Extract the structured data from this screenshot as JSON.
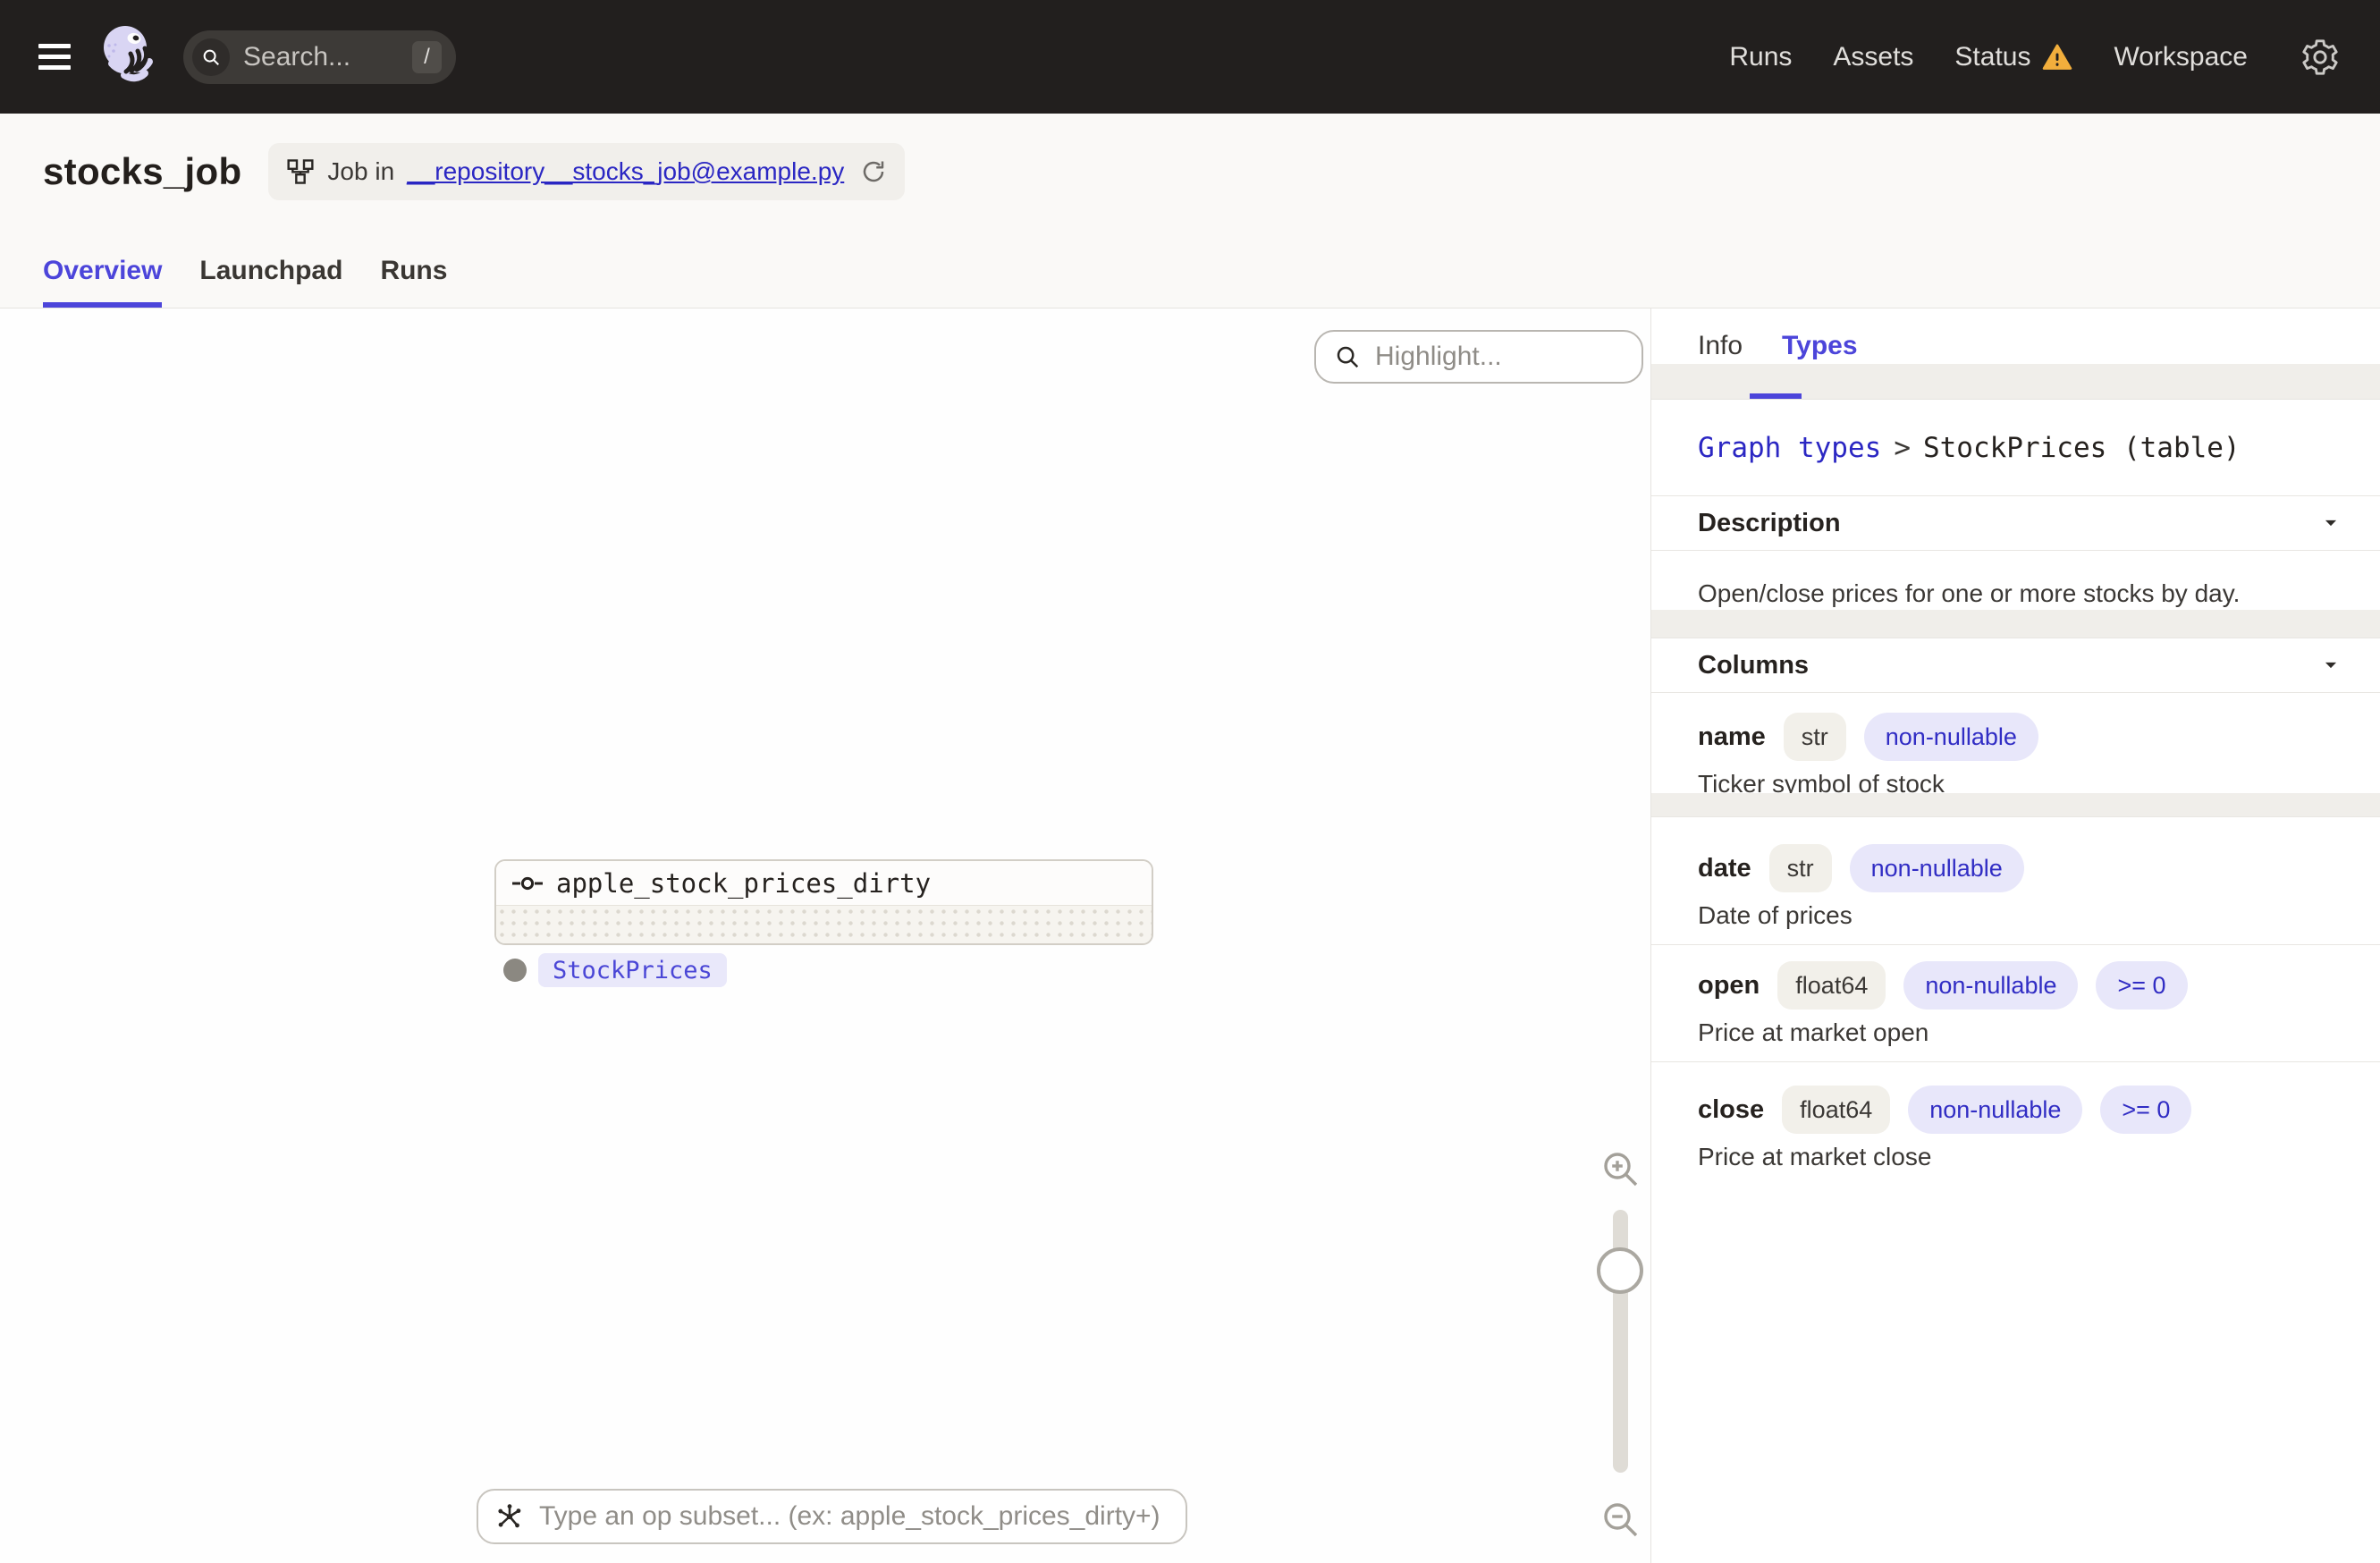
{
  "topnav": {
    "search": {
      "placeholder": "Search...",
      "shortcut": "/"
    },
    "links": [
      {
        "label": "Runs"
      },
      {
        "label": "Assets"
      },
      {
        "label": "Status",
        "has_warning": true
      },
      {
        "label": "Workspace"
      }
    ]
  },
  "header": {
    "title": "stocks_job",
    "job_context": {
      "prefix": "Job in",
      "link": "__repository__stocks_job@example.py"
    },
    "tabs": [
      {
        "label": "Overview",
        "active": true
      },
      {
        "label": "Launchpad",
        "active": false
      },
      {
        "label": "Runs",
        "active": false
      }
    ]
  },
  "canvas": {
    "highlight_placeholder": "Highlight...",
    "node": {
      "label": "apple_stock_prices_dirty",
      "output_type": "StockPrices"
    },
    "op_subset_placeholder": "Type an op subset... (ex: apple_stock_prices_dirty+)"
  },
  "sidebar": {
    "tabs": [
      {
        "label": "Info",
        "active": false
      },
      {
        "label": "Types",
        "active": true
      }
    ],
    "breadcrumb": {
      "link": "Graph types",
      "separator": ">",
      "current": "StockPrices (table)"
    },
    "description_section": {
      "title": "Description",
      "text": "Open/close prices for one or more stocks by day."
    },
    "columns_section": {
      "title": "Columns"
    },
    "columns": [
      {
        "name": "name",
        "type": "str",
        "tags": [
          "non-nullable"
        ],
        "description": "Ticker symbol of stock"
      },
      {
        "name": "date",
        "type": "str",
        "tags": [
          "non-nullable"
        ],
        "description": "Date of prices"
      },
      {
        "name": "open",
        "type": "float64",
        "tags": [
          "non-nullable",
          ">= 0"
        ],
        "description": "Price at market open"
      },
      {
        "name": "close",
        "type": "float64",
        "tags": [
          "non-nullable",
          ">= 0"
        ],
        "description": "Price at market close"
      }
    ]
  },
  "colors": {
    "accent": "#4C45DA",
    "link": "#2B27C3",
    "warning": "#F2AE3C",
    "tag_bg": "#E8E7FA",
    "tag_text": "#312DC4",
    "topnav_bg": "#221F1E"
  }
}
